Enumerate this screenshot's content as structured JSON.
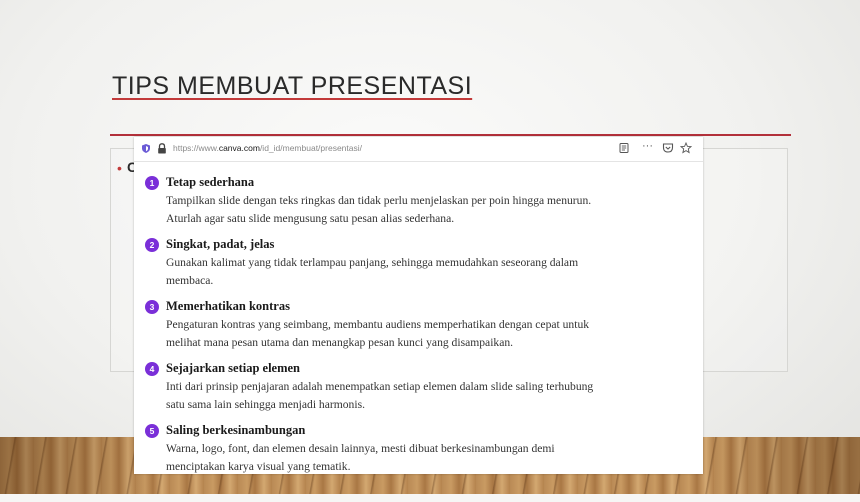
{
  "slide": {
    "title": "TIPS MEMBUAT PRESENTASI",
    "bullet_char": "C"
  },
  "browser": {
    "url_prefix": "https://www.",
    "url_domain": "canva.com",
    "url_path": "/id_id/membuat/presentasi/",
    "more_label": "···"
  },
  "tips": [
    {
      "number": "1",
      "title": "Tetap sederhana",
      "lines": [
        "Tampilkan slide dengan teks ringkas dan tidak perlu menjelaskan per poin hingga menurun.",
        "Aturlah agar satu slide mengusung satu pesan alias sederhana."
      ]
    },
    {
      "number": "2",
      "title": "Singkat, padat, jelas",
      "lines": [
        "Gunakan kalimat yang tidak terlampau panjang, sehingga memudahkan seseorang dalam",
        "membaca."
      ]
    },
    {
      "number": "3",
      "title": "Memerhatikan kontras",
      "lines": [
        "Pengaturan kontras yang seimbang, membantu audiens memperhatikan dengan cepat untuk",
        "melihat mana pesan utama dan menangkap pesan kunci yang disampaikan."
      ]
    },
    {
      "number": "4",
      "title": "Sejajarkan setiap elemen",
      "lines": [
        "Inti dari prinsip penjajaran adalah menempatkan setiap elemen dalam slide saling terhubung",
        "satu sama lain sehingga menjadi harmonis."
      ]
    },
    {
      "number": "5",
      "title": "Saling berkesinambungan",
      "lines": [
        "Warna, logo, font, dan elemen desain lainnya, mesti dibuat berkesinambungan demi",
        "menciptakan karya visual yang tematik."
      ]
    }
  ],
  "colors": {
    "accent_red": "#b2303a",
    "tip_badge": "#7a2fd8"
  }
}
